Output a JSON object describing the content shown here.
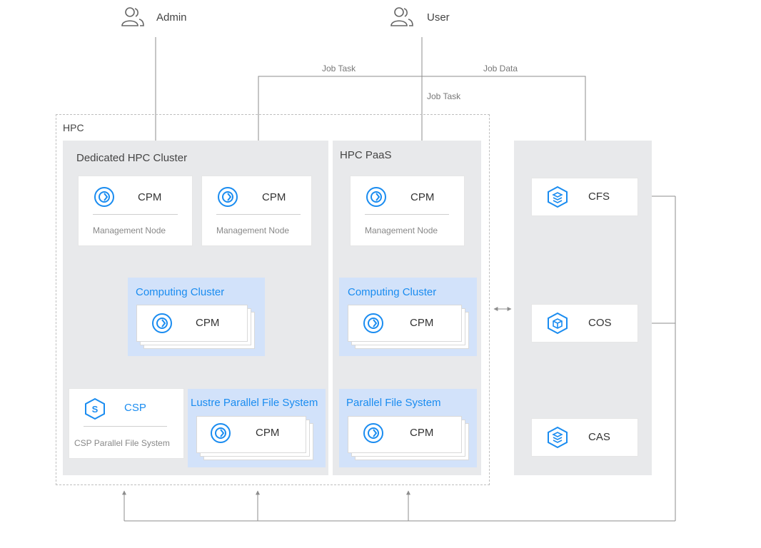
{
  "actors": {
    "admin": "Admin",
    "user": "User"
  },
  "flows": {
    "job_task_left": "Job Task",
    "job_data": "Job Data",
    "job_task_user": "Job Task"
  },
  "hpc": {
    "label": "HPC",
    "dedicated": {
      "title": "Dedicated HPC Cluster",
      "mgmt_nodes": [
        {
          "title": "CPM",
          "sub": "Management Node"
        },
        {
          "title": "CPM",
          "sub": "Management Node"
        }
      ],
      "computing": {
        "title": "Computing Cluster",
        "node": "CPM"
      },
      "csp": {
        "title": "CSP",
        "sub": "CSP Parallel File System"
      },
      "lustre": {
        "title": "Lustre Parallel File System",
        "node": "CPM"
      }
    },
    "paas": {
      "title": "HPC PaaS",
      "mgmt_node": {
        "title": "CPM",
        "sub": "Management Node"
      },
      "computing": {
        "title": "Computing Cluster",
        "node": "CPM"
      },
      "pfs": {
        "title": "Parallel File System",
        "node": "CPM"
      }
    }
  },
  "storage": {
    "cfs": "CFS",
    "cos": "COS",
    "cas": "CAS"
  },
  "colors": {
    "accent": "#1a8cf0",
    "panel": "#e8e9eb",
    "blue_panel": "#d2e2fa",
    "line": "#8c8c8c"
  }
}
